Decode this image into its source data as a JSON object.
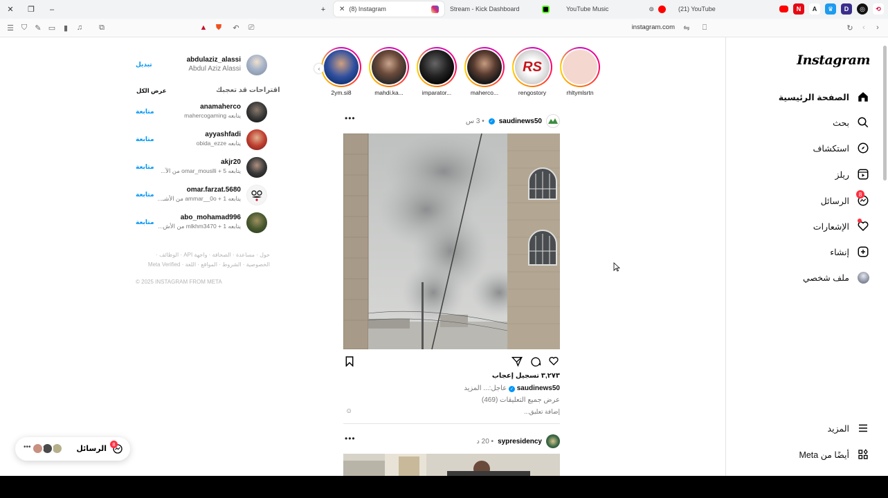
{
  "browser": {
    "tabs": [
      {
        "label": "(8) Instagram",
        "active": true,
        "favicon_color": "#d62976"
      },
      {
        "label": "Stream - Kick Dashboard",
        "active": false,
        "favicon_color": "#53fc18"
      },
      {
        "label": "YouTube Music",
        "active": false,
        "favicon_color": "#ff0000"
      },
      {
        "label": "(21) YouTube",
        "active": false,
        "favicon_color": "#ff0000"
      }
    ],
    "url": "instagram.com"
  },
  "nav": {
    "logo": "Instagram",
    "items": [
      {
        "label": "الصفحة الرئيسية",
        "icon": "home-icon"
      },
      {
        "label": "بحث",
        "icon": "search-icon"
      },
      {
        "label": "استكشاف",
        "icon": "compass-icon"
      },
      {
        "label": "ريلز",
        "icon": "reels-icon"
      },
      {
        "label": "الرسائل",
        "icon": "messenger-icon",
        "badge": "8"
      },
      {
        "label": "الإشعارات",
        "icon": "heart-icon"
      },
      {
        "label": "إنشاء",
        "icon": "plus-square-icon"
      },
      {
        "label": "ملف شخصي",
        "icon": "avatar"
      }
    ],
    "more_label": "المزيد",
    "meta_label": "أيضًا من Meta"
  },
  "stories": [
    {
      "username": "rhltymlsrtn"
    },
    {
      "username": "rengostory"
    },
    {
      "username": "maherco..."
    },
    {
      "username": "imparator..."
    },
    {
      "username": "mahdi.ka..."
    },
    {
      "username": "2ym.si8"
    }
  ],
  "post1": {
    "username": "saudinews50",
    "time": "• 3 س",
    "likes": "٣,٢٧٣ تسجيل إعجاب",
    "caption_user": "saudinews50",
    "caption_text": "عاجل:... المزيد",
    "view_comments": "عرض جميع التعليقات (469)",
    "add_comment": "إضافة تعليق..."
  },
  "post2": {
    "username": "sypresidency",
    "time": "• 20 د"
  },
  "me": {
    "username": "abdulaziz_alassi",
    "fullname": "Abdul Aziz Alassi",
    "switch": "تبديل"
  },
  "suggestions": {
    "title": "اقتراحات قد تعجبك",
    "see_all": "عرض الكل",
    "follow_label": "متابعة",
    "items": [
      {
        "username": "anamaherco",
        "sub": "يتابعه mahercogaming"
      },
      {
        "username": "ayyashfadi",
        "sub": "يتابعه obida_ezze"
      },
      {
        "username": "akjr20",
        "sub": "يتابعه omar_mouslli + 5 من الآ..."
      },
      {
        "username": "omar.farzat.5680",
        "sub": "يتابعه ammar__0o + 1 من الأشـ..."
      },
      {
        "username": "abo_mohamad996",
        "sub": "يتابعه mlkhm3470 + 1 من الأش..."
      }
    ]
  },
  "footer": {
    "links1": "حول · مساعدة · الصحافة · واجهة API · الوظائف ·",
    "links2": "الخصوصية · الشروط · المواقع · اللغة · Meta Verified",
    "copyright": "© 2025 INSTAGRAM FROM META"
  },
  "messages_pill": {
    "label": "الرسائل",
    "badge": "8"
  }
}
